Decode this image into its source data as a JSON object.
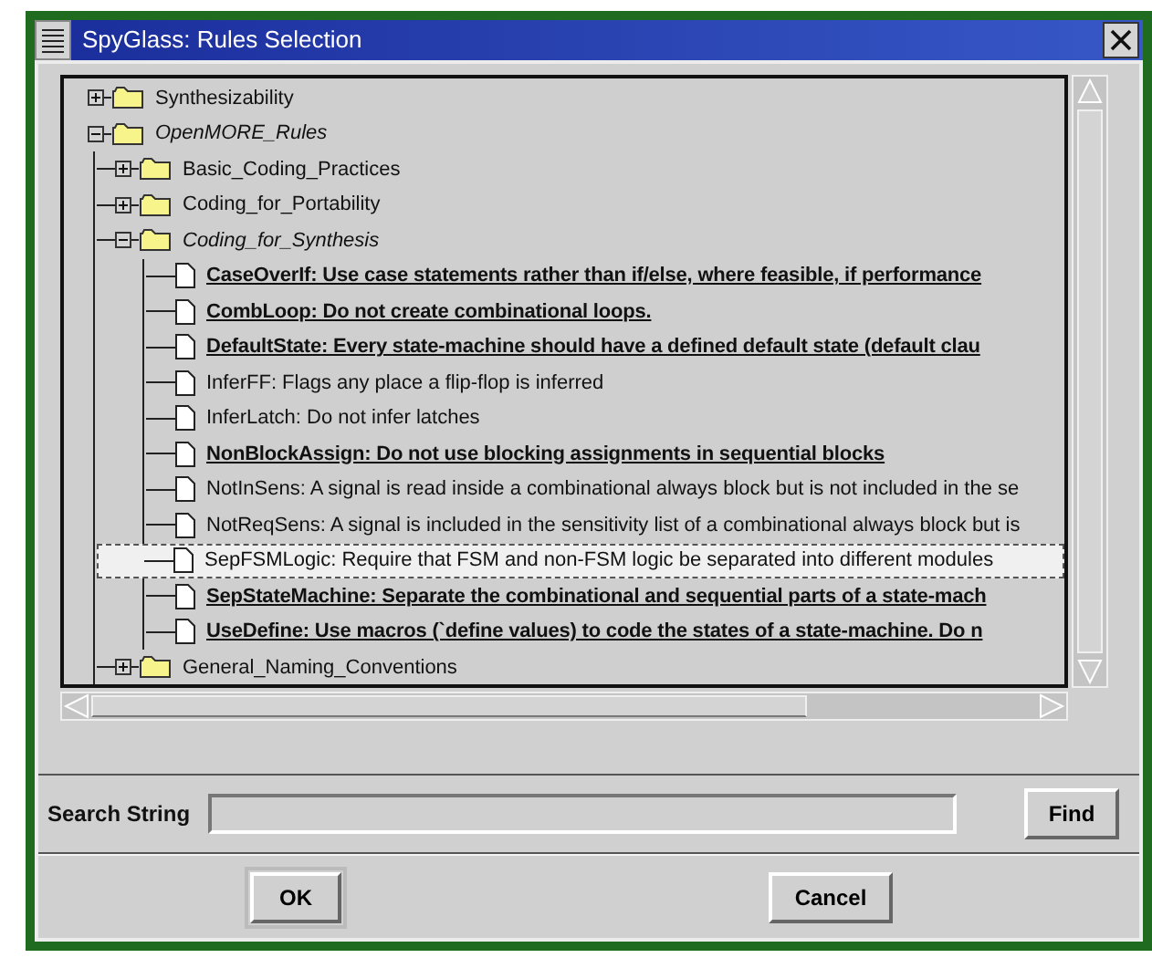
{
  "window": {
    "title": "SpyGlass: Rules Selection"
  },
  "tree": [
    {
      "label": "Synthesizability",
      "kind": "folder",
      "expanded": false,
      "selected": false
    },
    {
      "label": "OpenMORE_Rules",
      "kind": "folder",
      "expanded": true,
      "selected": false,
      "children": [
        {
          "label": "Basic_Coding_Practices",
          "kind": "folder",
          "expanded": false,
          "selected": false
        },
        {
          "label": "Coding_for_Portability",
          "kind": "folder",
          "expanded": false,
          "selected": false
        },
        {
          "label": "Coding_for_Synthesis",
          "kind": "folder",
          "expanded": true,
          "selected": false,
          "children": [
            {
              "label": "CaseOverIf: Use case statements rather than if/else, where feasible, if performance",
              "kind": "rule",
              "selected": true,
              "focused": false
            },
            {
              "label": "CombLoop: Do not create combinational loops.",
              "kind": "rule",
              "selected": true,
              "focused": false
            },
            {
              "label": "DefaultState: Every state-machine should have a defined default state (default clau",
              "kind": "rule",
              "selected": true,
              "focused": false
            },
            {
              "label": "InferFF: Flags any place a flip-flop is inferred",
              "kind": "rule",
              "selected": false,
              "focused": false
            },
            {
              "label": "InferLatch: Do not infer latches",
              "kind": "rule",
              "selected": false,
              "focused": false
            },
            {
              "label": "NonBlockAssign: Do not use blocking assignments in sequential blocks",
              "kind": "rule",
              "selected": true,
              "focused": false
            },
            {
              "label": "NotInSens: A signal is read inside a combinational always block but is not included in the se",
              "kind": "rule",
              "selected": false,
              "focused": false
            },
            {
              "label": "NotReqSens: A signal is included in the sensitivity list of a combinational always block but is",
              "kind": "rule",
              "selected": false,
              "focused": false
            },
            {
              "label": "SepFSMLogic: Require that FSM and non-FSM logic be separated into different modules",
              "kind": "rule",
              "selected": false,
              "focused": true
            },
            {
              "label": "SepStateMachine: Separate the combinational and sequential parts of a state-mach",
              "kind": "rule",
              "selected": true,
              "focused": false
            },
            {
              "label": "UseDefine: Use macros (`define values) to code the states of a state-machine. Do n",
              "kind": "rule",
              "selected": true,
              "focused": false
            }
          ]
        },
        {
          "label": "General_Naming_Conventions",
          "kind": "folder",
          "expanded": false,
          "selected": false
        }
      ]
    }
  ],
  "search": {
    "label": "Search String",
    "button": "Find"
  },
  "buttons": [
    {
      "label": "OK",
      "default": true
    },
    {
      "label": "Cancel",
      "default": false
    }
  ]
}
